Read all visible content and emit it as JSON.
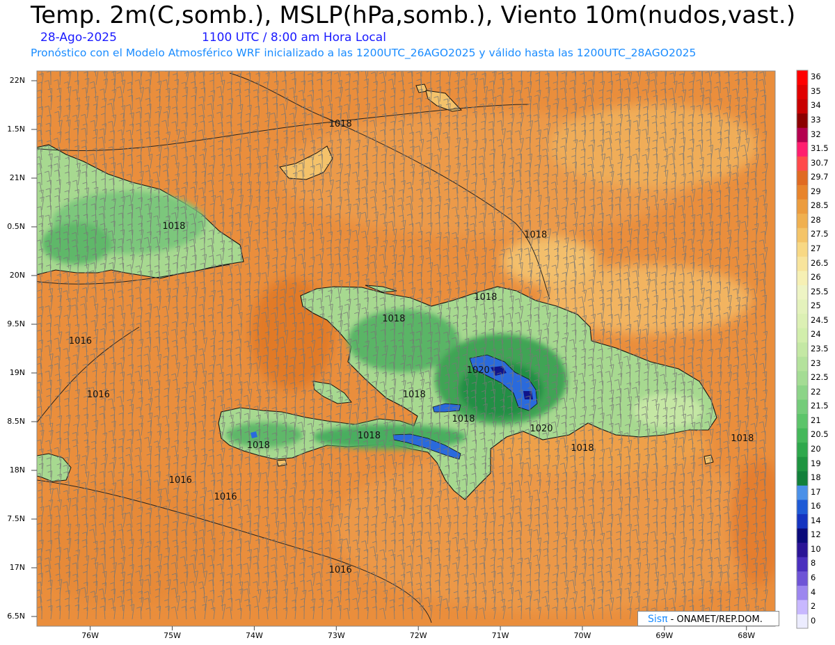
{
  "header": {
    "title": "Temp. 2m(C,somb.), MSLP(hPa,somb.), Viento 10m(nudos,vast.)",
    "date": "28-Ago-2025",
    "time": "1100 UTC / 8:00 am Hora Local",
    "subtitle": "Pronóstico con el Modelo Atmosférico WRF inicializado a las 1200UTC_26AGO2025 y válido hasta las  1200UTC_28AGO2025"
  },
  "axes": {
    "lat_labels": [
      "22N",
      "1.5N",
      "21N",
      "0.5N",
      "20N",
      "9.5N",
      "19N",
      "8.5N",
      "18N",
      "7.5N",
      "17N",
      "6.5N"
    ],
    "lat_values": [
      22,
      21.5,
      21,
      20.5,
      20,
      19.5,
      19,
      18.5,
      18,
      17.5,
      17,
      16.5
    ],
    "lon_labels": [
      "76W",
      "75W",
      "74W",
      "73W",
      "72W",
      "71W",
      "70W",
      "69W",
      "68W"
    ],
    "lon_values": [
      -76,
      -75,
      -74,
      -73,
      -72,
      -71,
      -70,
      -69,
      -68
    ],
    "lon_range": [
      -76.65,
      -67.65
    ],
    "lat_range": [
      16.4,
      22.1
    ]
  },
  "isobars": [
    {
      "label": "1018",
      "lon": -72.95,
      "lat": 21.53
    },
    {
      "label": "1018",
      "lon": -74.98,
      "lat": 20.48
    },
    {
      "label": "1018",
      "lon": -70.57,
      "lat": 20.39
    },
    {
      "label": "1018",
      "lon": -71.18,
      "lat": 19.75
    },
    {
      "label": "1018",
      "lon": -72.3,
      "lat": 19.53
    },
    {
      "label": "1016",
      "lon": -76.12,
      "lat": 19.3
    },
    {
      "label": "1020",
      "lon": -71.27,
      "lat": 19.0
    },
    {
      "label": "1016",
      "lon": -75.9,
      "lat": 18.75
    },
    {
      "label": "1018",
      "lon": -72.05,
      "lat": 18.75
    },
    {
      "label": "1018",
      "lon": -71.45,
      "lat": 18.5
    },
    {
      "label": "1020",
      "lon": -70.5,
      "lat": 18.4
    },
    {
      "label": "1018",
      "lon": -72.6,
      "lat": 18.33
    },
    {
      "label": "1018",
      "lon": -73.95,
      "lat": 18.23
    },
    {
      "label": "1018",
      "lon": -70.0,
      "lat": 18.2
    },
    {
      "label": "1018",
      "lon": -68.05,
      "lat": 18.3
    },
    {
      "label": "1016",
      "lon": -74.9,
      "lat": 17.87
    },
    {
      "label": "1016",
      "lon": -74.35,
      "lat": 17.7
    },
    {
      "label": "1016",
      "lon": -72.95,
      "lat": 16.95
    }
  ],
  "colorbar": {
    "labels": [
      "0",
      "2",
      "4",
      "6",
      "8",
      "10",
      "12",
      "14",
      "16",
      "17",
      "18",
      "19",
      "20",
      "20.5",
      "21",
      "21.5",
      "22",
      "22.5",
      "23",
      "23.5",
      "24",
      "24.5",
      "25",
      "25.5",
      "26",
      "26.5",
      "27",
      "27.5",
      "28",
      "28.5",
      "29",
      "29.7",
      "30.7",
      "31.5",
      "32",
      "33",
      "34",
      "35",
      "36"
    ],
    "colors": [
      "#ececff",
      "#c8b8ff",
      "#9c86ef",
      "#6e54d6",
      "#4a2fbe",
      "#2a1496",
      "#0a0a7a",
      "#1433c0",
      "#1e5ad6",
      "#4a90e8",
      "#12803a",
      "#1e9440",
      "#2ea84c",
      "#44b85a",
      "#5cc46a",
      "#74cc7a",
      "#8cd488",
      "#a4dc94",
      "#b4e29c",
      "#c4e8a4",
      "#d2eeac",
      "#dcf0b4",
      "#e4f2bc",
      "#eef4c4",
      "#f6f0b4",
      "#f8e49c",
      "#f8d884",
      "#f4c468",
      "#f0b050",
      "#ec9c3e",
      "#e8842c",
      "#e06a22",
      "#ff4a4a",
      "#ff1e6e",
      "#b4004e",
      "#8c0000",
      "#c80000",
      "#e00000",
      "#ff0000"
    ]
  },
  "credit": {
    "brand": "Sisπ",
    "org": " - ONAMET/REP.DOM."
  }
}
